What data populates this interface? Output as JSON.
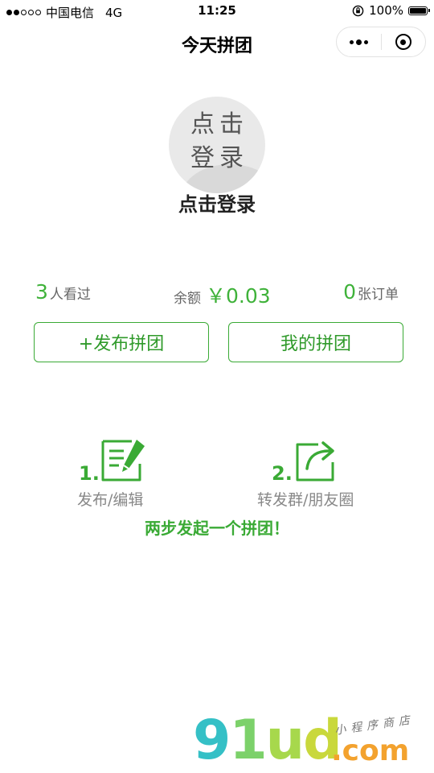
{
  "status_bar": {
    "carrier": "中国电信",
    "network": "4G",
    "time": "11:25",
    "battery": "100%",
    "battery_level": 1.0,
    "signal_filled": 2,
    "signal_total": 5
  },
  "nav": {
    "title": "今天拼团"
  },
  "profile": {
    "avatar_text_line1": "点击",
    "avatar_text_line2": "登录",
    "login_label": "点击登录"
  },
  "stats": {
    "views_count": "3",
    "views_label": "人看过",
    "balance_label": "余额",
    "balance_value": "￥0.03",
    "orders_count": "0",
    "orders_label": "张订单"
  },
  "actions": {
    "publish_label": "+发布拼团",
    "mine_label": "我的拼团"
  },
  "steps": {
    "step1_num": "1.",
    "step1_label": "发布/编辑",
    "step2_num": "2.",
    "step2_label": "转发群/朋友圈",
    "caption": "两步发起一个拼团！"
  },
  "watermark": {
    "logo_text": "91ud",
    "dotcom": ".com",
    "subtitle": "小程序商店"
  },
  "colors": {
    "accent_green": "#3aaa35",
    "number_green": "#3fb23a",
    "muted_text": "#888888"
  },
  "icons": {
    "more": "more-dots-icon",
    "close": "capsule-close-icon",
    "edit": "edit-document-icon",
    "share": "share-forward-icon"
  }
}
